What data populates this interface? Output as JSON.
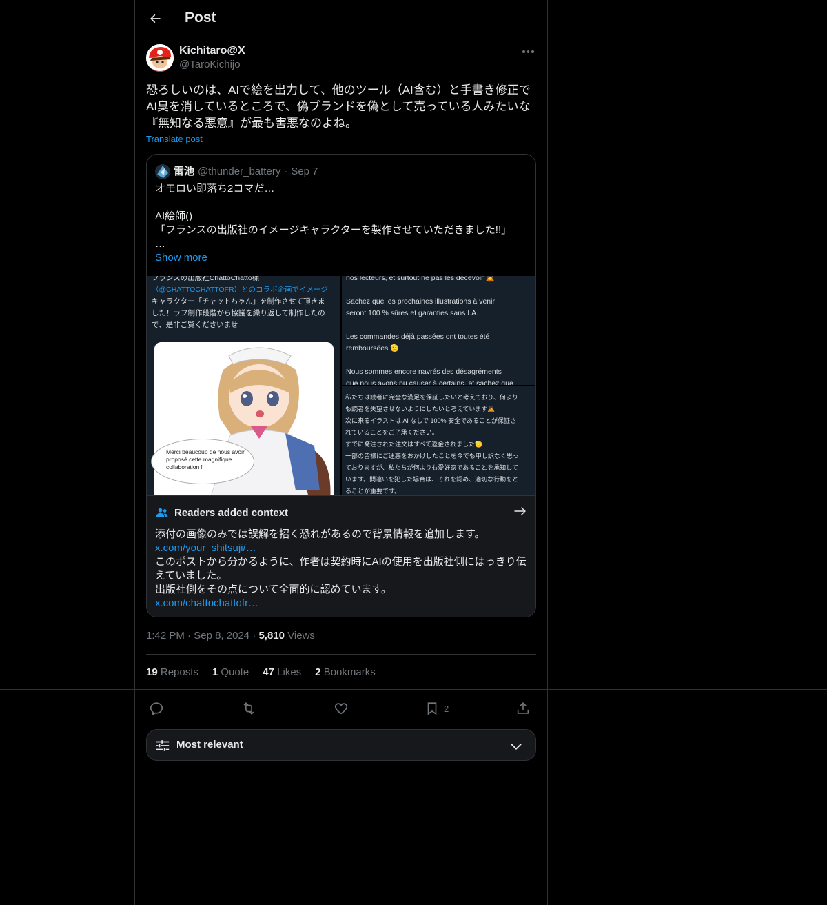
{
  "header": {
    "title": "Post"
  },
  "post": {
    "author_name": "Kichitaro@X",
    "author_handle": "@TaroKichijo",
    "text_lines": [
      "恐ろしいのは、AIで絵を出力して、他のツール（AI含む）と手書き修正で",
      "AI臭を消しているところで、偽ブランドを偽として売っている人みたいな",
      "『無知なる悪意』が最も害悪なのよね。"
    ],
    "translate_label": "Translate post",
    "timestamp": "1:42 PM",
    "date": "Sep 8, 2024",
    "views_count": "5,810",
    "views_label": "Views"
  },
  "quote": {
    "name": "雷池",
    "handle": "@thunder_battery",
    "date": "Sep 7",
    "lines": [
      "オモロい即落ち2コマだ…",
      "",
      "AI絵師()",
      "「フランスの出版社のイメージキャラクターを製作させていただきました!!」",
      "…"
    ],
    "show_more": "Show more",
    "media": {
      "left_lines": [
        "フランスの出版社ChattoChatto様",
        "（@CHATTOCHATTOFR）とのコラボ企画でイメージ",
        "キャラクター「チャットちゃん」を制作させて頂きま",
        "した！ラフ制作段階から協議を繰り返して制作したの",
        "で、是非ご覧くださいませ"
      ],
      "bubble_text": "Merci beaucoup de nous avoir proposé cette magnifique collaboration !",
      "right_top_lines": [
        "nos lecteurs, et surtout ne pas les décevoir 🙇",
        "",
        "Sachez que les prochaines illustrations à venir",
        "seront 100 % sûres et garanties sans I.A.",
        "",
        "Les commandes déjà passées ont toutes été",
        "remboursées 🫡",
        "",
        "Nous sommes encore navrés des désagréments",
        "que nous avons pu causer à certains, et sachez que"
      ],
      "right_bottom_lines": [
        "私たちは読者に完全な満足を保証したいと考えており、何より",
        "も読者を失望させないようにしたいと考えています🙇",
        "次に来るイラストは AI なしで 100% 安全であることが保証さ",
        "れていることをご了承ください。",
        "すでに発注された注文はすべて返金されました🫡",
        "一部の皆様にご迷惑をおかけしたことを今でも申し訳なく思っ",
        "ておりますが、私たちが何よりも愛好家であることを承知して",
        "います。間違いを犯した場合は、それを認め、適切な行動をと",
        "ることが重要です。"
      ]
    }
  },
  "notes": {
    "title": "Readers added context",
    "line1": "添付の画像のみでは誤解を招く恐れがあるので背景情報を追加します。",
    "link1": "x.com/your_shitsuji/…",
    "line2": "このポストから分かるように、作者は契約時にAIの使用を出版社側にはっきり伝",
    "line3": "えていました。",
    "line4": "出版社側をその点について全面的に認めています。",
    "link2": "x.com/chattochattofr…"
  },
  "stats": {
    "reposts_count": "19",
    "reposts_label": "Reposts",
    "quotes_count": "1",
    "quotes_label": "Quote",
    "likes_count": "47",
    "likes_label": "Likes",
    "bookmarks_count": "2",
    "bookmarks_label": "Bookmarks"
  },
  "actions": {
    "bookmark_count": "2"
  },
  "sort": {
    "label": "Most relevant"
  },
  "colors": {
    "background": "#000000",
    "accent": "#1d9bf0",
    "border": "#2f3336",
    "muted": "#71767b",
    "text": "#e7e9ea"
  },
  "icons": [
    "back-arrow-icon",
    "more-icon",
    "people-icon",
    "arrow-right-icon",
    "reply-icon",
    "repost-icon",
    "like-icon",
    "bookmark-icon",
    "share-icon",
    "sliders-icon",
    "chevron-down-icon"
  ]
}
